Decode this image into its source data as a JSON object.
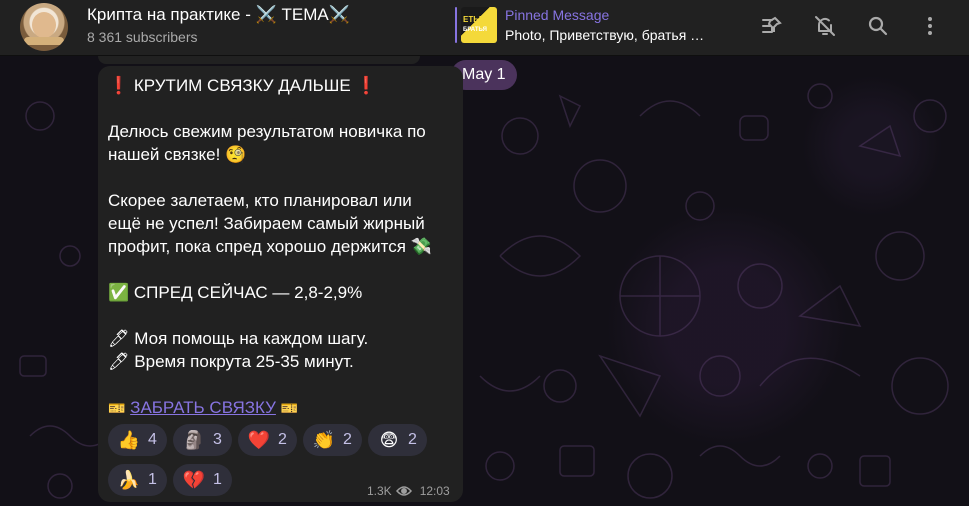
{
  "header": {
    "title": "Крипта на практике - ⚔️ ТЕМА⚔️",
    "subscribers": "8 361 subscribers",
    "pinned_label": "Pinned Message",
    "pinned_text": "Photo, Приветствую, братья …",
    "pinned_thumb_top": "ЕТЫ",
    "pinned_thumb_bottom": "БРАТЬЯ",
    "icons": [
      "unpin-list-icon",
      "mute-bell-icon",
      "search-icon",
      "more-vertical-icon"
    ]
  },
  "date_pill": "May 1",
  "message": {
    "lines": [
      "❗️ КРУТИМ СВЯЗКУ ДАЛЬШЕ ❗️",
      "",
      "Делюсь свежим результатом новичка по",
      "нашей связке! 🧐",
      "",
      "Скорее залетаем, кто планировал или",
      "ещё не успел! Забираем самый жирный",
      "профит, пока спред хорошо держится 💸",
      "",
      "✅ СПРЕД СЕЙЧАС — 2,8-2,9%",
      "",
      "🖊 Моя помощь на каждом шагу.",
      "🖊 Время покрута 25-35 минут."
    ],
    "link_prefix": "🎫",
    "link_text": "ЗАБРАТЬ СВЯЗКУ",
    "link_suffix": "🎫",
    "views": "1.3K",
    "time": "12:03"
  },
  "reactions": [
    {
      "emoji": "👍",
      "count": "4"
    },
    {
      "emoji": "🗿",
      "count": "3"
    },
    {
      "emoji": "❤️",
      "count": "2"
    },
    {
      "emoji": "👏",
      "count": "2"
    },
    {
      "emoji": "😨",
      "count": "2"
    },
    {
      "emoji": "🍌",
      "count": "1"
    },
    {
      "emoji": "💔",
      "count": "1"
    }
  ],
  "colors": {
    "accent": "#8774e1",
    "header_bg": "#212121",
    "bubble_bg": "#212121",
    "reaction_bg": "#2f2f3a"
  }
}
